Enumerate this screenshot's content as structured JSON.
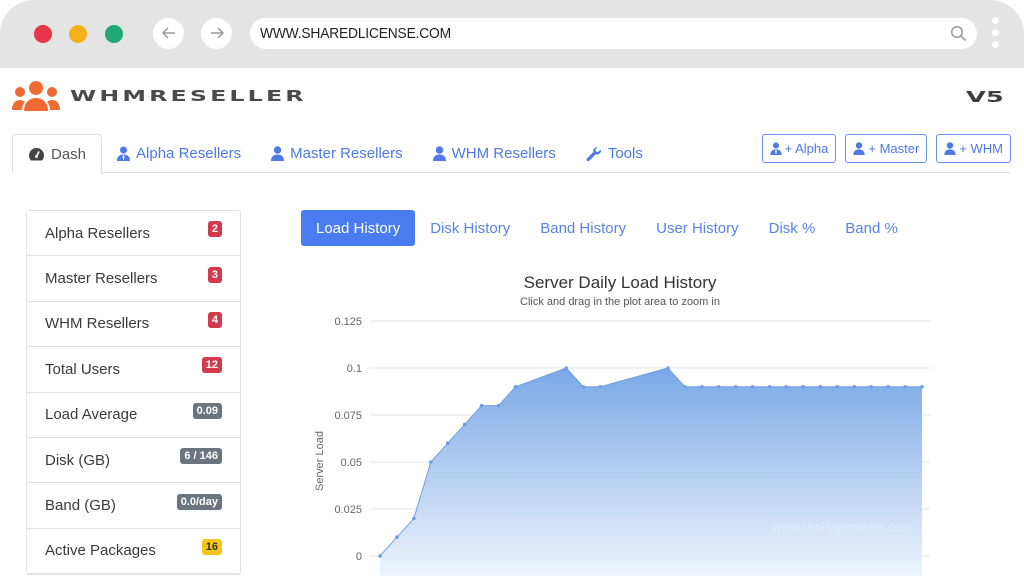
{
  "browser": {
    "url": "WWW.SHAREDLICENSE.COM",
    "traffic_lights": {
      "close": "#e8344a",
      "minimize": "#f5b11a",
      "maximize": "#1fa776"
    },
    "back_icon": "arrow-left-icon",
    "forward_icon": "arrow-right-icon",
    "search_icon": "search-icon"
  },
  "header": {
    "logo_text": "WHMRESELLER",
    "logo_icon": "users-group-icon",
    "version": "V5",
    "brand_color": "#ef6b35"
  },
  "nav": {
    "tabs": [
      {
        "label": "Dash",
        "icon": "dashboard-gauge-icon",
        "active": true
      },
      {
        "label": "Alpha Resellers",
        "icon": "user-tie-icon",
        "active": false
      },
      {
        "label": "Master Resellers",
        "icon": "user-icon",
        "active": false
      },
      {
        "label": "WHM Resellers",
        "icon": "user-icon",
        "active": false
      },
      {
        "label": "Tools",
        "icon": "wrench-icon",
        "active": false
      }
    ],
    "add_buttons": [
      {
        "label": "+ Alpha",
        "icon": "user-tie-icon"
      },
      {
        "label": "+ Master",
        "icon": "user-icon"
      },
      {
        "label": "+ WHM",
        "icon": "user-icon"
      }
    ],
    "accent": "#4f78e8"
  },
  "stats": [
    {
      "label": "Alpha Resellers",
      "value": "2",
      "color": "red"
    },
    {
      "label": "Master Resellers",
      "value": "3",
      "color": "red"
    },
    {
      "label": "WHM Resellers",
      "value": "4",
      "color": "red"
    },
    {
      "label": "Total Users",
      "value": "12",
      "color": "red"
    },
    {
      "label": "Load Average",
      "value": "0.09",
      "color": "gray"
    },
    {
      "label": "Disk (GB)",
      "value": "6 / 146",
      "color": "gray"
    },
    {
      "label": "Band (GB)",
      "value": "0.0/day",
      "color": "gray"
    },
    {
      "label": "Active Packages",
      "value": "16",
      "color": "yellow"
    }
  ],
  "chart_tabs": [
    {
      "label": "Load History",
      "active": true
    },
    {
      "label": "Disk History",
      "active": false
    },
    {
      "label": "Band History",
      "active": false
    },
    {
      "label": "User History",
      "active": false
    },
    {
      "label": "Disk %",
      "active": false
    },
    {
      "label": "Band %",
      "active": false
    }
  ],
  "chart_data": {
    "type": "area",
    "title": "Server Daily Load History",
    "subtitle": "Click and drag in the plot area to zoom in",
    "xlabel": "",
    "ylabel": "Server Load",
    "ylim": [
      0,
      0.125
    ],
    "yticks": [
      0,
      0.025,
      0.05,
      0.075,
      0.1,
      0.125
    ],
    "ytick_labels": [
      "0",
      "0.025",
      "0.05",
      "0.075",
      "0.1",
      "0.125"
    ],
    "grid": true,
    "xlim": [
      0,
      32
    ],
    "x": [
      0,
      1,
      2,
      3,
      4,
      5,
      6,
      7,
      8,
      11,
      12,
      13,
      17,
      18,
      19,
      20,
      21,
      22,
      23,
      24,
      25,
      26,
      27,
      28,
      29,
      30,
      31,
      32
    ],
    "series": [
      {
        "name": "Server Load",
        "values": [
          0,
          0.01,
          0.02,
          0.05,
          0.06,
          0.07,
          0.08,
          0.08,
          0.09,
          0.1,
          0.09,
          0.09,
          0.1,
          0.09,
          0.09,
          0.09,
          0.09,
          0.09,
          0.09,
          0.09,
          0.09,
          0.09,
          0.09,
          0.09,
          0.09,
          0.09,
          0.09,
          0.09
        ],
        "color": "#7caae6"
      }
    ],
    "watermark": "www.reallygreatsite.com"
  }
}
